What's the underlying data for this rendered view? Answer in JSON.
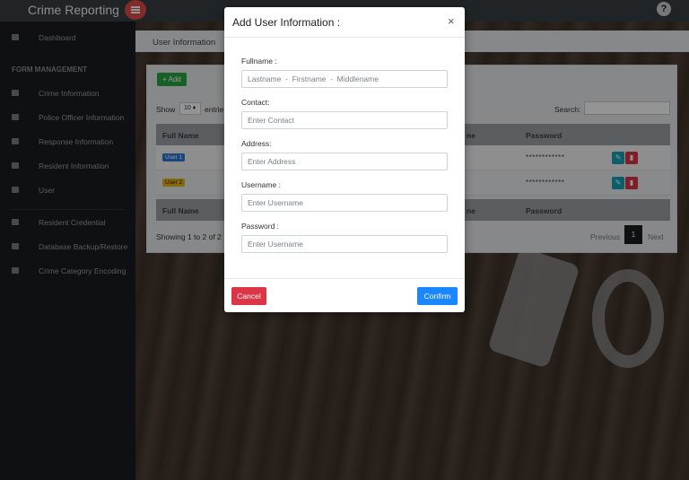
{
  "app": {
    "brand": "Crime Reporting",
    "avatar_glyph": "?"
  },
  "sidebar": {
    "section_label": "FORM MANAGEMENT",
    "items": [
      {
        "label": "Dashboard",
        "icon": "cloud-icon"
      },
      {
        "label": "Crime Information",
        "icon": "folder-icon"
      },
      {
        "label": "Police Officer Information",
        "icon": "file-icon"
      },
      {
        "label": "Response Information",
        "icon": "file-icon"
      },
      {
        "label": "Resident Information",
        "icon": "file-icon"
      },
      {
        "label": "User",
        "icon": "users-icon"
      },
      {
        "label": "Resident Credential",
        "icon": "file-icon"
      },
      {
        "label": "Database Backup/Restore",
        "icon": "database-icon"
      },
      {
        "label": "Crime Category Encoding",
        "icon": "folder-icon"
      }
    ]
  },
  "page": {
    "title": "User Information",
    "add_label": "+ Add",
    "show_label": "Show",
    "entries_label": "entrie",
    "page_size": "10 ♦",
    "search_label": "Search:",
    "columns": {
      "full_name": "Full Name",
      "username": "ne",
      "password": "Password"
    },
    "rows": [
      {
        "badge": "User 1",
        "password": "************"
      },
      {
        "badge": "User 2",
        "password": "************"
      }
    ],
    "showing_text": "Showing 1 to 2 of 2",
    "pagination": {
      "prev": "Previous",
      "current": "1",
      "next": "Next"
    }
  },
  "modal": {
    "title": "Add User Information :",
    "close": "×",
    "fields": {
      "fullname": {
        "label": "Fullname :",
        "placeholder": "Lastname  -  Firstname  -  Middlename"
      },
      "contact": {
        "label": "Contact:",
        "placeholder": "Enter Contact"
      },
      "address": {
        "label": "Address:",
        "placeholder": "Enter Address"
      },
      "username": {
        "label": "Username :",
        "placeholder": "Enter Username"
      },
      "password": {
        "label": "Password :",
        "placeholder": "Enter Username"
      }
    },
    "cancel_label": "Cancel",
    "confirm_label": "Confirm"
  },
  "colors": {
    "sidebar_bg": "#191c21",
    "danger": "#dc3545",
    "primary": "#1a86ff",
    "success": "#28a745"
  }
}
